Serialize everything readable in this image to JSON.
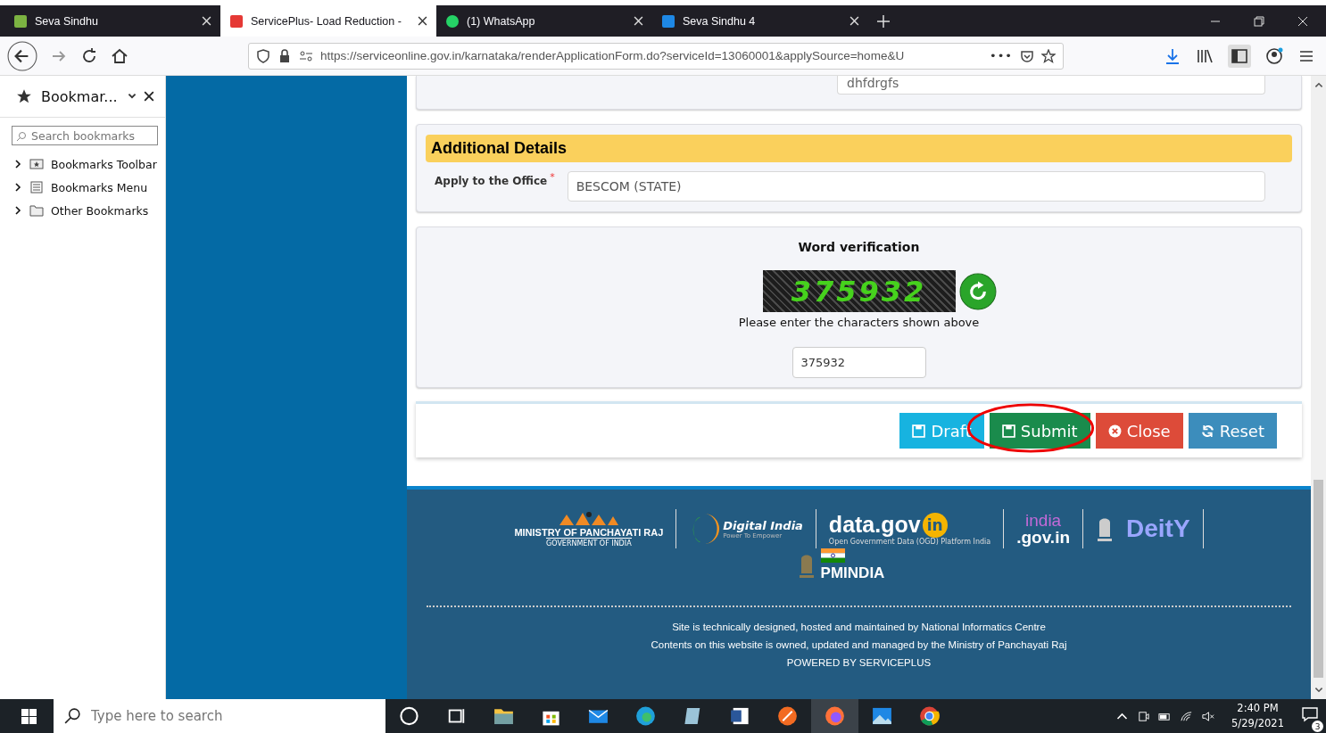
{
  "browser_tabs": [
    {
      "title": "Seva Sindhu",
      "selected": false
    },
    {
      "title": "ServicePlus- Load Reduction -",
      "selected": true
    },
    {
      "title": "(1) WhatsApp",
      "selected": false
    },
    {
      "title": "Seva Sindhu 4",
      "selected": false
    }
  ],
  "address_bar": {
    "url": "https://serviceonline.gov.in/karnataka/renderApplicationForm.do?serviceId=13060001&applySource=home&U",
    "more": "•••"
  },
  "bookmarks_sidebar": {
    "title": "Bookmar...",
    "search_placeholder": "Search bookmarks",
    "items": [
      {
        "label": "Bookmarks Toolbar",
        "expanded": false
      },
      {
        "label": "Bookmarks Menu",
        "expanded": false
      },
      {
        "label": "Other Bookmarks",
        "expanded": false
      }
    ]
  },
  "form": {
    "reason_value": "dhfdrgfs",
    "additional_details": {
      "heading": "Additional Details",
      "label": "Apply to the Office",
      "required_mark": "*",
      "value": "BESCOM (STATE)"
    },
    "word_verification": {
      "heading": "Word verification",
      "captcha": "375932",
      "hint": "Please enter the characters shown above",
      "value": "375932"
    },
    "buttons": [
      {
        "label": "Draft",
        "kind": "draft",
        "highlighted": false
      },
      {
        "label": "Submit",
        "kind": "submit",
        "highlighted": true
      },
      {
        "label": "Close",
        "kind": "close",
        "highlighted": false
      },
      {
        "label": "Reset",
        "kind": "reset",
        "highlighted": false
      }
    ]
  },
  "footer": {
    "logos": {
      "ministry": "MINISTRY OF PANCHAYATI RAJ",
      "ministry_sub": "GOVERNMENT OF INDIA",
      "digital_india": "Digital India",
      "digital_india_sub": "Power To Empower",
      "data_gov": "data.gov",
      "data_gov_in": "in",
      "data_gov_sub": "Open Government Data (OGD) Platform India",
      "india": "india",
      "india_gov": ".gov.in",
      "deity": "DeitY",
      "pmindia": "PMINDIA"
    },
    "lines": [
      "Site is technically designed, hosted and maintained by National Informatics Centre",
      "Contents on this website is owned, updated and managed by the Ministry of Panchayati Raj",
      "POWERED BY SERVICEPLUS"
    ]
  },
  "taskbar": {
    "search_placeholder": "Type here to search",
    "time": "2:40 PM",
    "date": "5/29/2021",
    "notifications": "3"
  }
}
